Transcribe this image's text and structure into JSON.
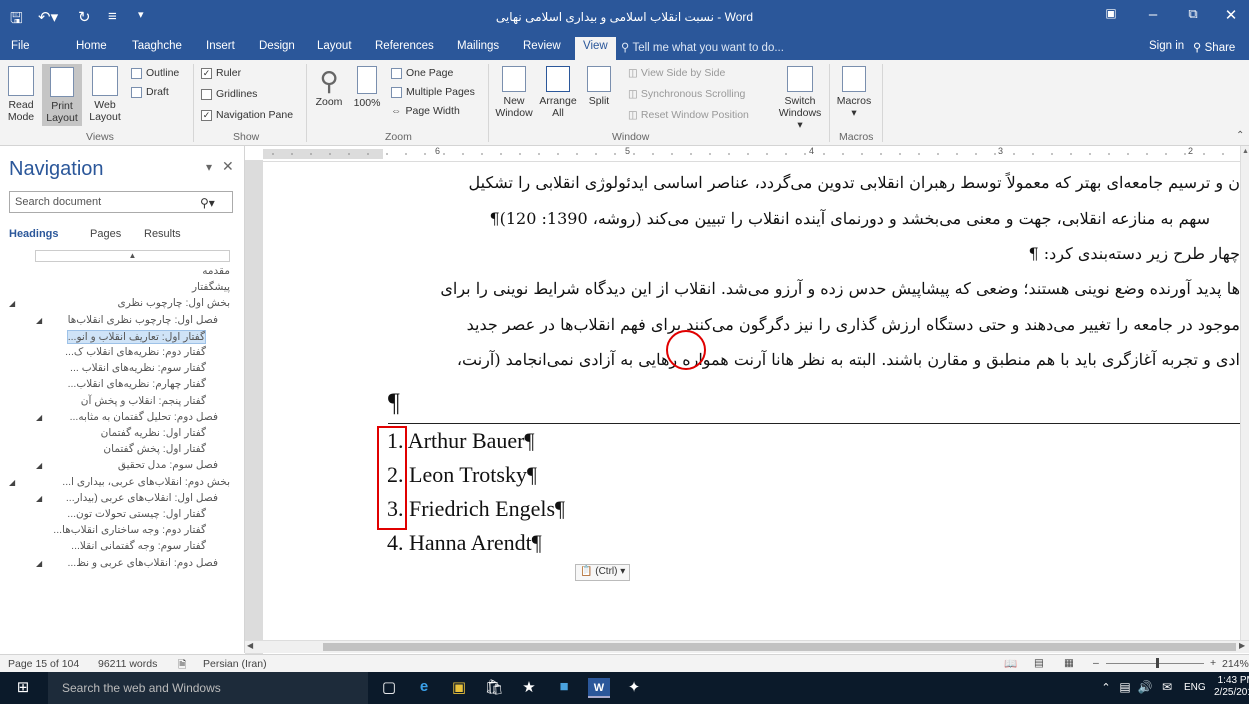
{
  "window": {
    "title": "نسبت انقلاب اسلامی و بیداری اسلامی نهایی - Word",
    "controls": [
      "ribbon-display-icon",
      "minimize-icon",
      "restore-icon",
      "close-icon"
    ]
  },
  "tabs": [
    "File",
    "Home",
    "Taaghche",
    "Insert",
    "Design",
    "Layout",
    "References",
    "Mailings",
    "Review",
    "View"
  ],
  "active_tab": "View",
  "tell_me": "Tell me what you want to do...",
  "sign_in": "Sign in",
  "share": "Share",
  "ribbon": {
    "views": {
      "label": "Views",
      "read_mode": "Read Mode",
      "print_layout": "Print Layout",
      "web_layout": "Web Layout",
      "outline": "Outline",
      "draft": "Draft"
    },
    "show": {
      "label": "Show",
      "ruler": "Ruler",
      "gridlines": "Gridlines",
      "navigation_pane": "Navigation Pane",
      "ruler_checked": true,
      "gridlines_checked": false,
      "navigation_checked": true
    },
    "zoom": {
      "label": "Zoom",
      "zoom": "Zoom",
      "hundred": "100%",
      "one_page": "One Page",
      "multiple_pages": "Multiple Pages",
      "page_width": "Page Width"
    },
    "window": {
      "label": "Window",
      "new_window": "New Window",
      "arrange_all": "Arrange All",
      "split": "Split",
      "view_side_by_side": "View Side by Side",
      "synchronous_scrolling": "Synchronous Scrolling",
      "reset_window_position": "Reset Window Position",
      "switch_windows": "Switch Windows"
    },
    "macros": {
      "label": "Macros",
      "macros": "Macros"
    }
  },
  "nav": {
    "title": "Navigation",
    "search_placeholder": "Search document",
    "tabs": [
      "Headings",
      "Pages",
      "Results"
    ],
    "headings": [
      {
        "text": "مقدمه",
        "indent": 0
      },
      {
        "text": "پیشگفتار",
        "indent": 0
      },
      {
        "text": "بخش اول: چارچوب نظری",
        "indent": 0
      },
      {
        "text": "فصل اول: چارچوب نظری انقلاب‌ها",
        "indent": 1
      },
      {
        "text": "گفتار اول: تعاریف انقلاب و انو...",
        "indent": 2,
        "selected": true
      },
      {
        "text": "گفتار دوم: نظریه‌های انقلاب ک...",
        "indent": 2
      },
      {
        "text": "گفتار سوم: نظریه‌های انقلاب ...",
        "indent": 2
      },
      {
        "text": "گفتار چهارم: نظریه‌های انقلاب...",
        "indent": 2
      },
      {
        "text": "گفتار پنجم: انقلاب و پخش آن",
        "indent": 2
      },
      {
        "text": "فصل دوم: تحلیل گفتمان به مثابه...",
        "indent": 1
      },
      {
        "text": "گفتار اول: نظریه گفتمان",
        "indent": 2
      },
      {
        "text": "گفتار اول: پخش گفتمان",
        "indent": 2
      },
      {
        "text": "فصل سوم: مدل تحقیق",
        "indent": 1
      },
      {
        "text": "بخش دوم: انقلاب‌های عربی، بیداری ا...",
        "indent": 0
      },
      {
        "text": "فصل اول: انقلاب‌های عربی (بیدار...",
        "indent": 1
      },
      {
        "text": "گفتار اول: چیستی تحولات تون...",
        "indent": 2
      },
      {
        "text": "گفتار دوم: وجه ساختاری انقلاب‌ها...",
        "indent": 2
      },
      {
        "text": "گفتار سوم: وجه گفتمانی انقلا...",
        "indent": 2
      },
      {
        "text": "فصل دوم: انقلاب‌های عربی و نظ...",
        "indent": 1
      }
    ]
  },
  "ruler_numbers": [
    "6",
    "5",
    "4",
    "3",
    "2"
  ],
  "document": {
    "persian_lines": [
      "ن و ترسیم جامعه‌ای بهتر که معمولاً توسط رهبران انقلابی تدوین می‌گردد، عناصر اساسی ایدئولوژی انقلابی را تشکیل",
      "سهم به منازعه انقلابی، جهت و معنی می‌بخشد و دورنمای آینده انقلاب را تبیین می‌کند (روشه، 1390: 120)¶",
      "چهار طرح زیر دسته‌بندی کرد: ¶",
      "ها پدید آورنده وضع نوینی هستند؛ وضعی که پیشاپیش حدس زده و آرزو می‌شد. انقلاب از این دیدگاه شرایط نوینی را برای",
      "موجود در جامعه را تغییر می‌دهند و حتی دستگاه ارزش گذاری را نیز دگرگون می‌کنند برای فهم انقلاب‌ها در عصر جدید",
      "ادی و تجربه آغازگری باید با هم منطبق و مقارن باشند. البته به نظر هانا آرنت همواره رهایی به آزادی نمی‌انجامد (آرنت،"
    ],
    "pilcrow": "¶",
    "list": [
      "1. Arthur Bauer¶",
      "2. Leon Trotsky¶",
      "3. Friedrich Engels¶",
      "4. Hanna Arendt¶"
    ],
    "paste_options": "(Ctrl)"
  },
  "status": {
    "page": "Page 15 of 104",
    "words": "96211 words",
    "language": "Persian (Iran)",
    "zoom": "214%"
  },
  "taskbar": {
    "search": "Search the web and Windows",
    "lang": "ENG",
    "time": "1:43 PM",
    "date": "2/25/2016"
  },
  "colors": {
    "word_blue": "#2b579a",
    "annotation_red": "#e00000"
  }
}
